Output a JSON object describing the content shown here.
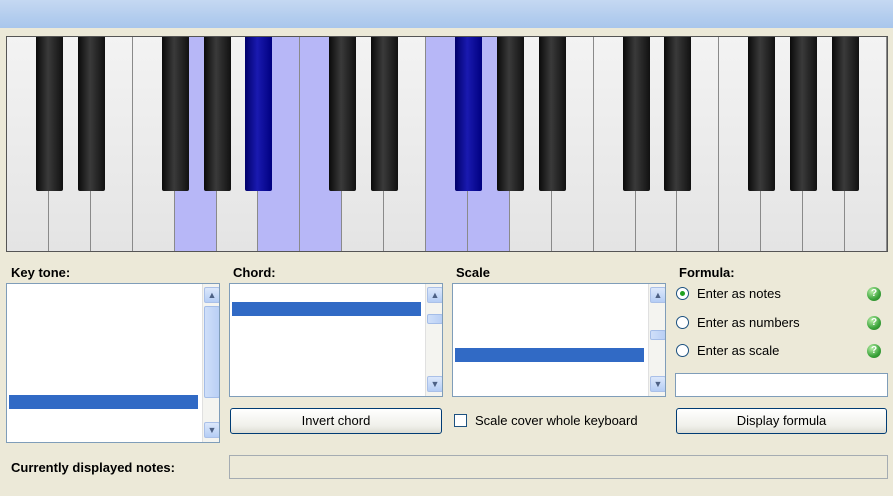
{
  "piano": {
    "white_keys_highlighted": [
      4,
      6,
      7,
      10,
      11
    ],
    "black_keys_highlighted": [
      4,
      7
    ]
  },
  "key_tone": {
    "label": "Key tone:"
  },
  "chord": {
    "label": "Chord:",
    "invert_button": "Invert chord"
  },
  "scale": {
    "label": "Scale",
    "cover_checkbox_label": "Scale cover whole keyboard",
    "cover_checked": false
  },
  "formula": {
    "label": "Formula:",
    "options": [
      "Enter as notes",
      "Enter as numbers",
      "Enter as scale"
    ],
    "selected_index": 0,
    "input_value": "",
    "display_button": "Display formula",
    "help_icon": "help-icon"
  },
  "status": {
    "label": "Currently displayed notes:",
    "value": ""
  },
  "colors": {
    "highlight_white": "#b7b7f7",
    "highlight_black": "#000080",
    "selection": "#316ac5",
    "radio_dot": "#21a121"
  }
}
